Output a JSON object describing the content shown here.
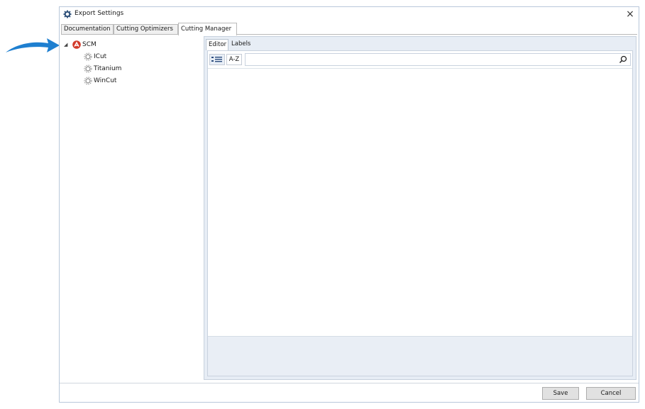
{
  "window": {
    "title": "Export Settings",
    "close_glyph": "×"
  },
  "tabs": [
    {
      "label": "Documentation"
    },
    {
      "label": "Cutting Optimizers"
    },
    {
      "label": "Cutting Manager",
      "active": true
    }
  ],
  "tree": {
    "root": {
      "label": "SCM",
      "expanded": true,
      "icon": "scm-logo"
    },
    "children": [
      {
        "label": "ICut",
        "icon": "gear-icon"
      },
      {
        "label": "Titanium",
        "icon": "gear-icon"
      },
      {
        "label": "WinCut",
        "icon": "gear-icon"
      }
    ]
  },
  "panel": {
    "tabs": [
      {
        "label": "Editor",
        "active": true
      },
      {
        "label": "Labels"
      }
    ],
    "sort_az_label": "A-Z",
    "search_value": ""
  },
  "buttons": {
    "save": "Save",
    "cancel": "Cancel"
  },
  "colors": {
    "arrow": "#1e7fd0",
    "scm_logo": "#d23a2a"
  }
}
